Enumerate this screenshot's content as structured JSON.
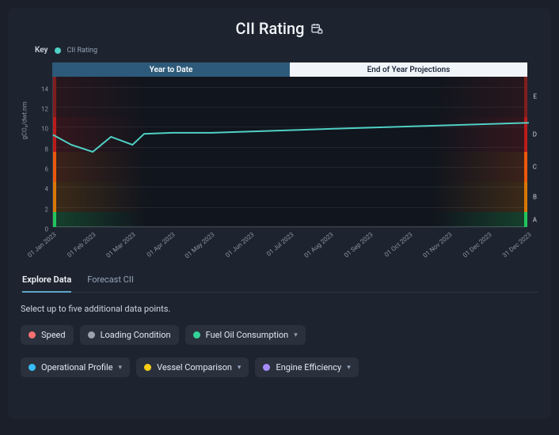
{
  "title": "CII Rating",
  "key": {
    "label": "Key",
    "series_name": "CII Rating",
    "series_color": "#4fd1c5"
  },
  "toggles": {
    "left": "Year to Date",
    "right": "End of Year Projections"
  },
  "chart_data": {
    "type": "line",
    "xlabel": "",
    "ylabel": "gCO₂/dwt.nm",
    "ylim": [
      0,
      15
    ],
    "y_ticks": [
      0,
      2,
      4,
      6,
      8,
      10,
      12,
      14
    ],
    "x_categories": [
      "01 Jan 2023",
      "01 Feb 2023",
      "01 Mar 2023",
      "01 Apr 2023",
      "01 May 2023",
      "01 Jun 2023",
      "01 Jul 2023",
      "01 Aug 2023",
      "01 Sep 2023",
      "01 Oct 2023",
      "01 Nov 2023",
      "01 Dec 2023",
      "31 Dec 2023"
    ],
    "series": [
      {
        "name": "CII Rating",
        "color": "#4fd1c5",
        "x": [
          "01 Jan 2023",
          "15 Jan 2023",
          "01 Feb 2023",
          "15 Feb 2023",
          "01 Mar 2023",
          "10 Mar 2023",
          "01 Apr 2023",
          "01 May 2023",
          "01 Aug 2023",
          "31 Dec 2023"
        ],
        "values": [
          9.2,
          8.2,
          7.5,
          9.0,
          8.2,
          9.3,
          9.4,
          9.4,
          9.8,
          10.4
        ]
      }
    ],
    "bands_axis": "y",
    "bands": [
      {
        "label": "A",
        "from": 0,
        "to": 1.5,
        "color": "#22c55e",
        "glow": "rgba(34,197,94,0.25)"
      },
      {
        "label": "B",
        "from": 1.5,
        "to": 4.5,
        "color": "#d97706",
        "glow": "rgba(217,119,6,0.22)"
      },
      {
        "label": "C",
        "from": 4.5,
        "to": 7.5,
        "color": "#ea580c",
        "glow": "rgba(234,88,12,0.20)"
      },
      {
        "label": "D",
        "from": 7.5,
        "to": 11,
        "color": "#b91c1c",
        "glow": "rgba(185,28,28,0.22)"
      },
      {
        "label": "E",
        "from": 11,
        "to": 15,
        "color": "#7f1d1d",
        "glow": "rgba(127,29,29,0.22)"
      }
    ]
  },
  "tabs": {
    "active": "Explore Data",
    "inactive": "Forecast CII"
  },
  "help_text": "Select up to five additional data points.",
  "chips_row1": [
    {
      "id": "speed",
      "label": "Speed",
      "color": "#f87171",
      "has_menu": false
    },
    {
      "id": "loading-condition",
      "label": "Loading Condition",
      "color": "#9ca3af",
      "has_menu": false
    },
    {
      "id": "fuel-oil",
      "label": "Fuel Oil Consumption",
      "color": "#34d399",
      "has_menu": true
    }
  ],
  "chips_row2": [
    {
      "id": "operational-profile",
      "label": "Operational Profile",
      "color": "#38bdf8",
      "has_menu": true
    },
    {
      "id": "vessel-comparison",
      "label": "Vessel Comparison",
      "color": "#facc15",
      "has_menu": true
    },
    {
      "id": "engine-efficiency",
      "label": "Engine Efficiency",
      "color": "#a78bfa",
      "has_menu": true
    }
  ]
}
